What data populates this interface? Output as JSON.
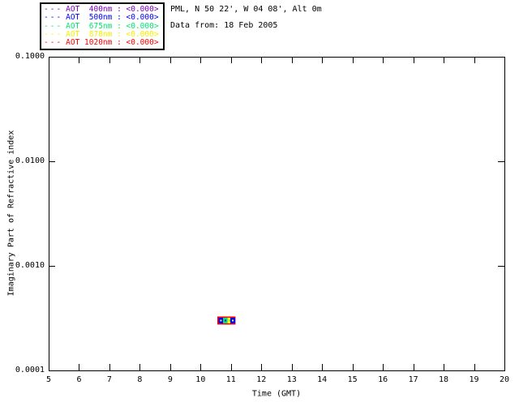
{
  "header": {
    "location": "PML, N 50 22', W 04 08', Alt 0m",
    "data_from": "Data from: 18 Feb 2005"
  },
  "legend": {
    "dash": "---",
    "entries": [
      {
        "label": "AOT  400nm : <0.000>",
        "color": "#7F00BF"
      },
      {
        "label": "AOT  500nm : <0.000>",
        "color": "#0000FF"
      },
      {
        "label": "AOT  675nm : <0.000>",
        "color": "#00E673"
      },
      {
        "label": "AOT  870nm : <0.000>",
        "color": "#F2F200"
      },
      {
        "label": "AOT 1020nm : <0.000>",
        "color": "#FF0000"
      }
    ]
  },
  "chart_data": {
    "type": "scatter",
    "title": "",
    "xlabel": "Time (GMT)",
    "ylabel": "Imaginary Part of Refractive index",
    "xlim": [
      5,
      20
    ],
    "ylim": [
      0.0001,
      0.1
    ],
    "yscale": "log",
    "grid": false,
    "legend_position": "top-left-outside",
    "xticks": [
      5,
      6,
      7,
      8,
      9,
      10,
      11,
      12,
      13,
      14,
      15,
      16,
      17,
      18,
      19,
      20
    ],
    "yticks": [
      {
        "label": "0.1000",
        "value": 0.1
      },
      {
        "label": "0.0100",
        "value": 0.01
      },
      {
        "label": "0.0010",
        "value": 0.001
      },
      {
        "label": "0.0001",
        "value": 0.0001
      }
    ],
    "series": [
      {
        "name": "AOT 400nm",
        "color": "#7F00BF",
        "x": [
          10.8
        ],
        "y": [
          0.0003
        ]
      },
      {
        "name": "AOT 500nm",
        "color": "#0000FF",
        "x": [
          10.8
        ],
        "y": [
          0.0003
        ]
      },
      {
        "name": "AOT 675nm",
        "color": "#00E673",
        "x": [
          10.8
        ],
        "y": [
          0.0003
        ]
      },
      {
        "name": "AOT 870nm",
        "color": "#F2F200",
        "x": [
          10.8
        ],
        "y": [
          0.0003
        ]
      },
      {
        "name": "AOT 1020nm",
        "color": "#FF0000",
        "x": [
          10.8
        ],
        "y": [
          0.0003
        ]
      }
    ],
    "marker_cluster": {
      "time_start": 10.55,
      "time_end": 11.15,
      "value": 0.0003,
      "outer_color": "#FF0000",
      "inner_marks": [
        {
          "time": 10.67,
          "color": "#0000FF",
          "dot": "#FFFF00"
        },
        {
          "time": 10.82,
          "color": "#00E673",
          "dot": "#0000FF"
        },
        {
          "time": 10.97,
          "color": "#FFFF00",
          "dot": "#00E673"
        },
        {
          "time": 11.06,
          "color": "#0000FF",
          "dot": "#FFFF00"
        }
      ]
    }
  }
}
